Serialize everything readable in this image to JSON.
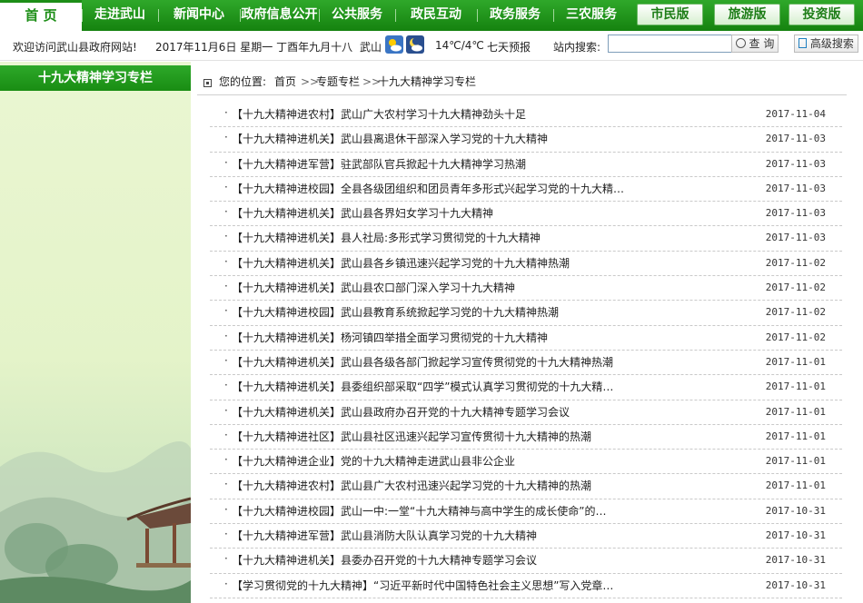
{
  "nav": {
    "items": [
      "首 页",
      "走进武山",
      "新闻中心",
      "政府信息公开",
      "公共服务",
      "政民互动",
      "政务服务",
      "三农服务"
    ],
    "versions": [
      "市民版",
      "旅游版",
      "投资版"
    ]
  },
  "infobar": {
    "welcome": "欢迎访问武山县政府网站!",
    "date": "2017年11月6日 星期一 丁酉年九月十八",
    "city": "武山",
    "temperature": "14℃/4℃",
    "forecast": "七天预报",
    "search_label": "站内搜索:",
    "search_value": "",
    "search_button": "查 询",
    "advanced": "高级搜索"
  },
  "sidebar": {
    "title": "十九大精神学习专栏"
  },
  "breadcrumb": {
    "label": "您的位置:",
    "path": [
      "首页",
      "专题专栏",
      "十九大精神学习专栏"
    ],
    "separator": ">>"
  },
  "news": [
    {
      "title": "【十九大精神进农村】武山广大农村学习十九大精神劲头十足",
      "date": "2017-11-04"
    },
    {
      "title": "【十九大精神进机关】武山县离退休干部深入学习党的十九大精神",
      "date": "2017-11-03"
    },
    {
      "title": "【十九大精神进军营】驻武部队官兵掀起十九大精神学习热潮",
      "date": "2017-11-03"
    },
    {
      "title": "【十九大精神进校园】全县各级团组织和团员青年多形式兴起学习党的十九大精…",
      "date": "2017-11-03"
    },
    {
      "title": "【十九大精神进机关】武山县各界妇女学习十九大精神",
      "date": "2017-11-03"
    },
    {
      "title": "【十九大精神进机关】县人社局:多形式学习贯彻党的十九大精神",
      "date": "2017-11-03"
    },
    {
      "title": "【十九大精神进机关】武山县各乡镇迅速兴起学习党的十九大精神热潮",
      "date": "2017-11-02"
    },
    {
      "title": "【十九大精神进机关】武山县农口部门深入学习十九大精神",
      "date": "2017-11-02"
    },
    {
      "title": "【十九大精神进校园】武山县教育系统掀起学习党的十九大精神热潮",
      "date": "2017-11-02"
    },
    {
      "title": "【十九大精神进机关】杨河镇四举措全面学习贯彻党的十九大精神",
      "date": "2017-11-02"
    },
    {
      "title": "【十九大精神进机关】武山县各级各部门掀起学习宣传贯彻党的十九大精神热潮",
      "date": "2017-11-01"
    },
    {
      "title": "【十九大精神进机关】县委组织部采取“四学”模式认真学习贯彻党的十九大精…",
      "date": "2017-11-01"
    },
    {
      "title": "【十九大精神进机关】武山县政府办召开党的十九大精神专题学习会议",
      "date": "2017-11-01"
    },
    {
      "title": "【十九大精神进社区】武山县社区迅速兴起学习宣传贯彻十九大精神的热潮",
      "date": "2017-11-01"
    },
    {
      "title": "【十九大精神进企业】党的十九大精神走进武山县非公企业",
      "date": "2017-11-01"
    },
    {
      "title": "【十九大精神进农村】武山县广大农村迅速兴起学习党的十九大精神的热潮",
      "date": "2017-11-01"
    },
    {
      "title": "【十九大精神进校园】武山一中:一堂“十九大精神与高中学生的成长使命”的…",
      "date": "2017-10-31"
    },
    {
      "title": "【十九大精神进军营】武山县消防大队认真学习党的十九大精神",
      "date": "2017-10-31"
    },
    {
      "title": "【十九大精神进机关】县委办召开党的十九大精神专题学习会议",
      "date": "2017-10-31"
    },
    {
      "title": "【学习贯彻党的十九大精神】“习近平新时代中国特色社会主义思想”写入党章…",
      "date": "2017-10-31"
    }
  ],
  "colors": {
    "nav_green": "#15820f",
    "accent": "#1d8e17",
    "sidebar_bg": "#eaf6d2"
  },
  "icons": {
    "weather_day": "sun-cloud-icon",
    "weather_night": "moon-cloud-icon",
    "search": "search-icon",
    "advanced": "doc-search-icon",
    "breadcrumb": "square-bullet-icon"
  }
}
